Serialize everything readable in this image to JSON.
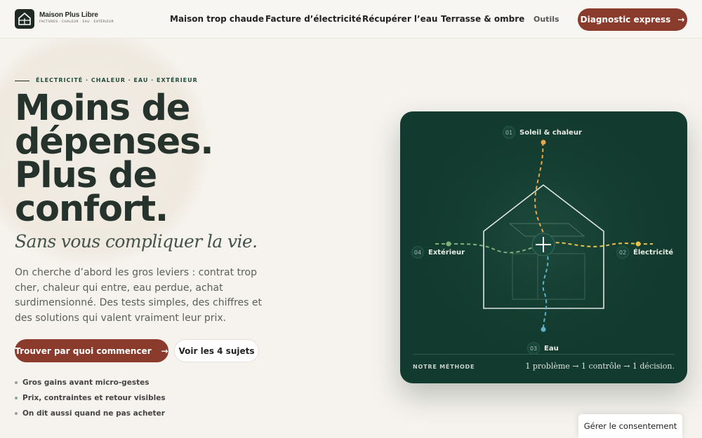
{
  "brand": {
    "name": "Maison Plus Libre",
    "tagline": "FACTURES · CHALEUR · EAU · EXTÉRIEUR"
  },
  "nav": {
    "items": [
      "Maison trop chaude",
      "Facture d’électricité",
      "Récupérer l’eau",
      "Terrasse & ombre"
    ],
    "tools": "Outils",
    "cta": "Diagnostic express",
    "cta_arrow": "→"
  },
  "hero": {
    "eyebrow": "ÉLECTRICITÉ · CHALEUR · EAU · EXTÉRIEUR",
    "title_lines": [
      "Moins de",
      "dépenses.",
      "Plus de",
      "confort."
    ],
    "subtitle": "Sans vous compliquer la vie.",
    "paragraph": "On cherche d’abord les gros leviers : contrat trop cher, chaleur qui entre, eau perdue, achat surdimensionné. Des tests simples, des chiffres et des solutions qui valent vraiment leur prix.",
    "primary_button": "Trouver par quoi commencer",
    "primary_arrow": "→",
    "secondary_button": "Voir les 4 sujets",
    "bullets": [
      "Gros gains avant micro-gestes",
      "Prix, contraintes et retour visibles",
      "On dit aussi quand ne pas acheter"
    ]
  },
  "diagram": {
    "labels": [
      {
        "num": "01",
        "text": "Soleil & chaleur"
      },
      {
        "num": "02",
        "text": "Électricité"
      },
      {
        "num": "03",
        "text": "Eau"
      },
      {
        "num": "04",
        "text": "Extérieur"
      }
    ],
    "footer_label": "NOTRE MÉTHODE",
    "footer_text": "1 problème → 1 contrôle → 1 décision.",
    "colors": {
      "background": "#123a2e",
      "sun": "#e7a64a",
      "electricity": "#e8c14e",
      "water": "#5fb3c9",
      "exterior": "#7fb07a"
    }
  },
  "consent": {
    "label": "Gérer le consentement"
  }
}
